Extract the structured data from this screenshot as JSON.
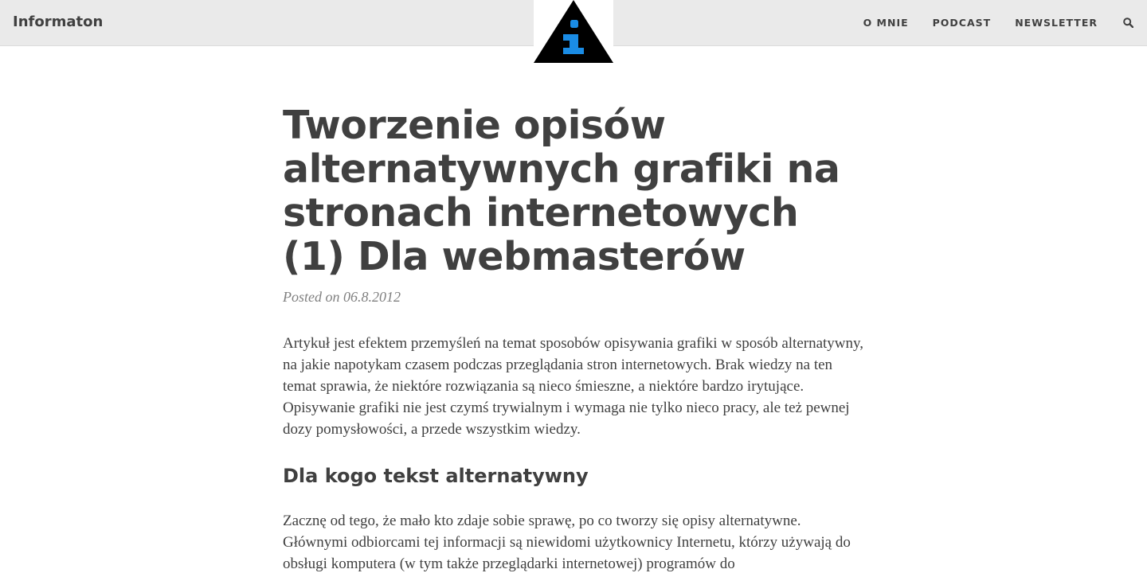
{
  "navbar": {
    "brand": "Informaton",
    "links": [
      "O MNIE",
      "PODCAST",
      "NEWSLETTER"
    ],
    "search_icon": "search-icon",
    "logo": {
      "icon": "info-triangle-icon",
      "triangle_color": "#000000",
      "glyph_color": "#1a8ce5"
    }
  },
  "post": {
    "title": "Tworzenie opisów alternatywnych grafiki na stronach internetowych (1) Dla webmasterów",
    "meta": "Posted on 06.8.2012",
    "paragraph_1": "Artykuł jest efektem przemyśleń na temat sposobów opisywania grafiki w sposób alternatywny, na jakie napotykam czasem podczas przeglądania stron internetowych. Brak wiedzy na ten temat sprawia, że niektóre rozwiązania są nieco śmieszne, a niektóre bardzo irytujące. Opisywanie grafiki nie jest czymś trywialnym i wymaga nie tylko nieco pracy, ale też pewnej dozy pomysłowości, a przede wszystkim wiedzy.",
    "heading_1": "Dla kogo tekst alternatywny",
    "paragraph_2": "Zacznę od tego, że mało kto zdaje sobie sprawę, po co tworzy się opisy alternatywne. Głównymi odbiorcami tej informacji są niewidomi użytkownicy Internetu, którzy używają do obsługi komputera (w tym także przeglądarki internetowej) programów do"
  },
  "colors": {
    "navbar_bg": "#eaeaea",
    "text": "#404040",
    "meta": "#808080",
    "accent": "#1a8ce5"
  }
}
